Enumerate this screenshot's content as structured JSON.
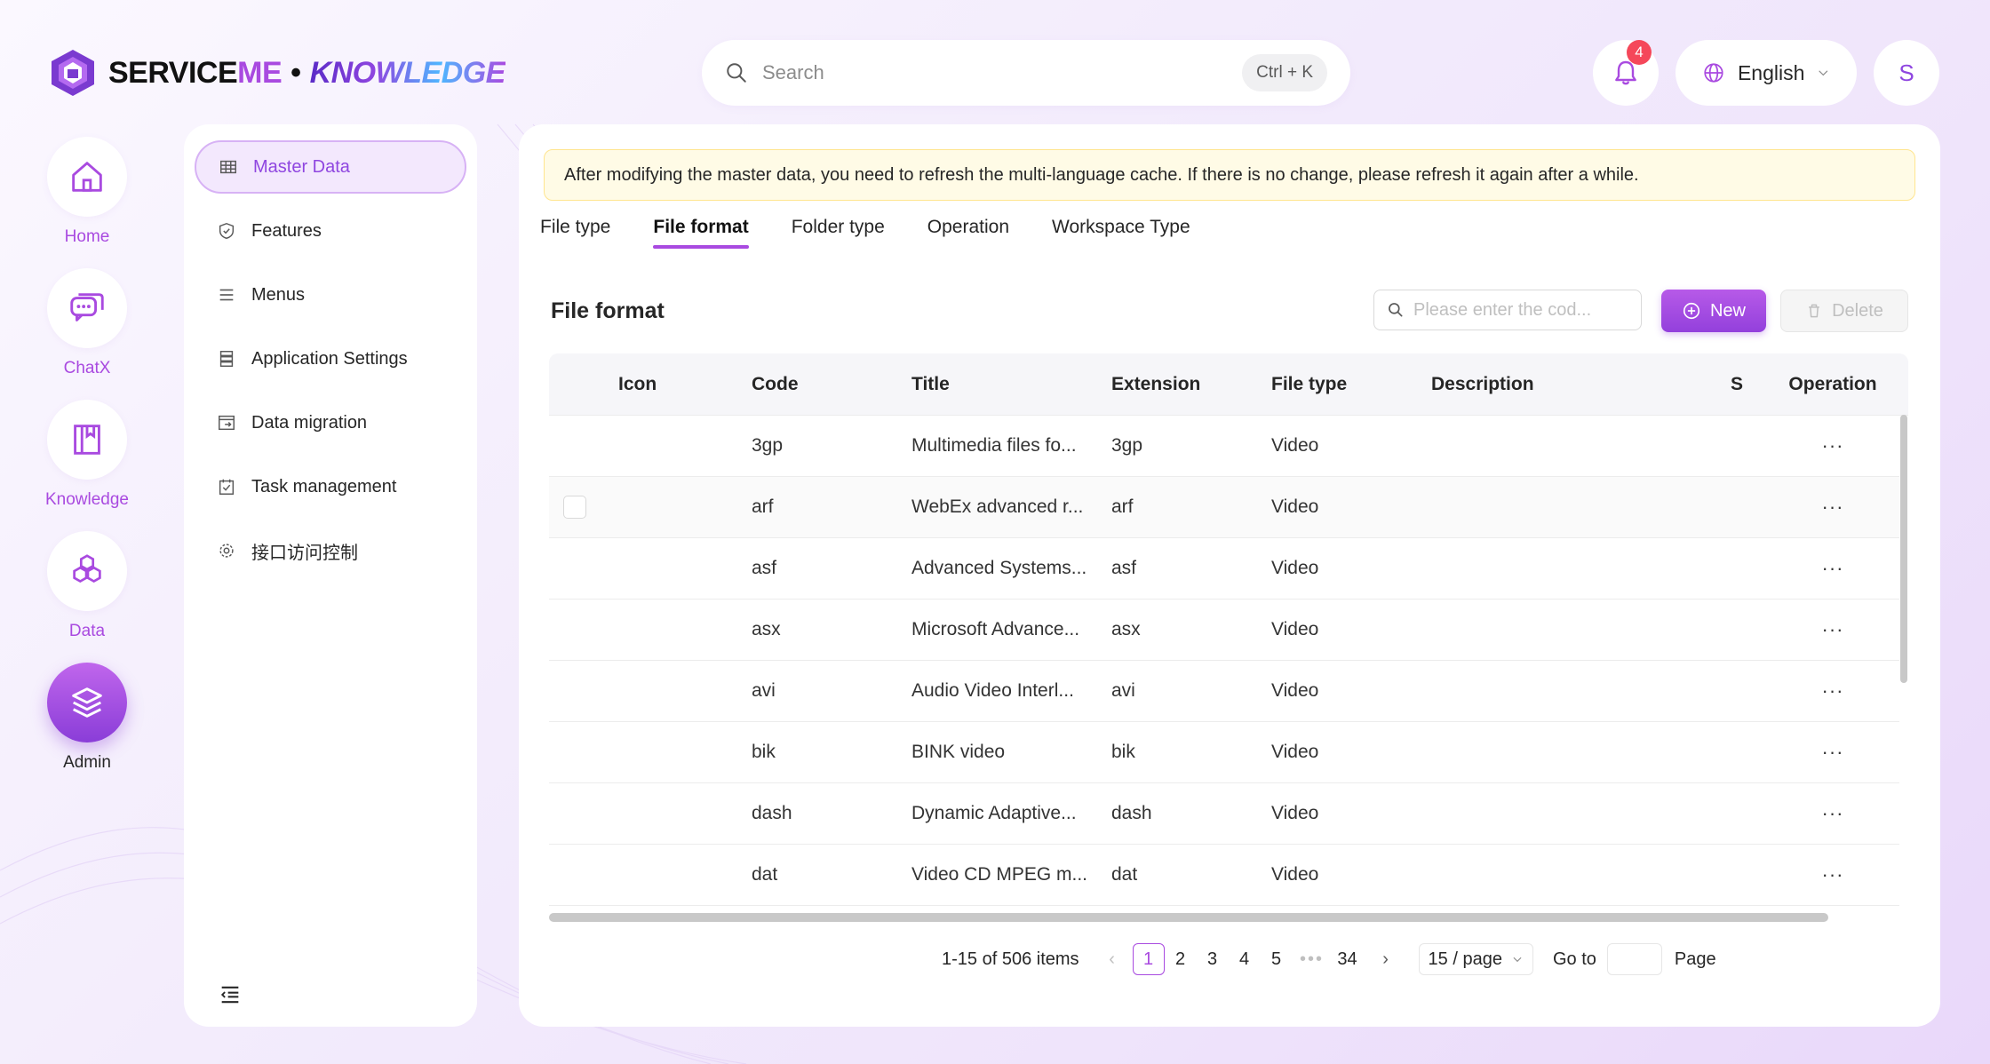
{
  "brand": {
    "service": "SERVICE",
    "me": "ME",
    "separator": "•",
    "knowledge": "KNOWLEDGE"
  },
  "header": {
    "search_placeholder": "Search",
    "search_shortcut": "Ctrl + K",
    "notification_count": "4",
    "language": "English",
    "avatar_initial": "S"
  },
  "rail": {
    "items": [
      {
        "label": "Home",
        "icon": "home-icon"
      },
      {
        "label": "ChatX",
        "icon": "chat-icon"
      },
      {
        "label": "Knowledge",
        "icon": "book-icon"
      },
      {
        "label": "Data",
        "icon": "hexagons-icon"
      },
      {
        "label": "Admin",
        "icon": "layers-icon",
        "active": true
      }
    ]
  },
  "sidenav": {
    "items": [
      {
        "label": "Master Data",
        "icon": "table-icon",
        "active": true
      },
      {
        "label": "Features",
        "icon": "shield-icon"
      },
      {
        "label": "Menus",
        "icon": "list-icon"
      },
      {
        "label": "Application Settings",
        "icon": "server-icon"
      },
      {
        "label": "Data migration",
        "icon": "migration-icon"
      },
      {
        "label": "Task management",
        "icon": "checklist-icon"
      },
      {
        "label": "接口访问控制",
        "icon": "settings-icon"
      }
    ]
  },
  "main": {
    "notice": "After modifying the master data, you need to refresh the multi-language cache. If there is no change, please refresh it again after a while.",
    "tabs": [
      "File type",
      "File format",
      "Folder type",
      "Operation",
      "Workspace Type"
    ],
    "active_tab": "File format",
    "section_title": "File format",
    "code_search_placeholder": "Please enter the cod...",
    "new_label": "New",
    "delete_label": "Delete"
  },
  "table": {
    "columns": [
      "Icon",
      "Code",
      "Title",
      "Extension",
      "File type",
      "Description",
      "S",
      "Operation"
    ],
    "rows": [
      {
        "code": "3gp",
        "title": "Multimedia files fo...",
        "ext": "3gp",
        "type": "Video",
        "description": ""
      },
      {
        "code": "arf",
        "title": "WebEx advanced r...",
        "ext": "arf",
        "type": "Video",
        "description": ""
      },
      {
        "code": "asf",
        "title": "Advanced Systems...",
        "ext": "asf",
        "type": "Video",
        "description": ""
      },
      {
        "code": "asx",
        "title": "Microsoft Advance...",
        "ext": "asx",
        "type": "Video",
        "description": ""
      },
      {
        "code": "avi",
        "title": "Audio Video Interl...",
        "ext": "avi",
        "type": "Video",
        "description": ""
      },
      {
        "code": "bik",
        "title": "BINK video",
        "ext": "bik",
        "type": "Video",
        "description": ""
      },
      {
        "code": "dash",
        "title": "Dynamic Adaptive...",
        "ext": "dash",
        "type": "Video",
        "description": ""
      },
      {
        "code": "dat",
        "title": "Video CD MPEG m...",
        "ext": "dat",
        "type": "Video",
        "description": ""
      }
    ],
    "row_action": "···"
  },
  "pagination": {
    "total_text": "1-15 of 506 items",
    "pages": [
      "1",
      "2",
      "3",
      "4",
      "5"
    ],
    "current": "1",
    "ellipsis": "•••",
    "last": "34",
    "page_size": "15 / page",
    "goto_label": "Go to",
    "page_label": "Page"
  },
  "colors": {
    "accent": "#a94ae0",
    "accent_dark": "#8a3dd8",
    "notice_bg": "#fffbe6",
    "badge": "#f5475a"
  }
}
